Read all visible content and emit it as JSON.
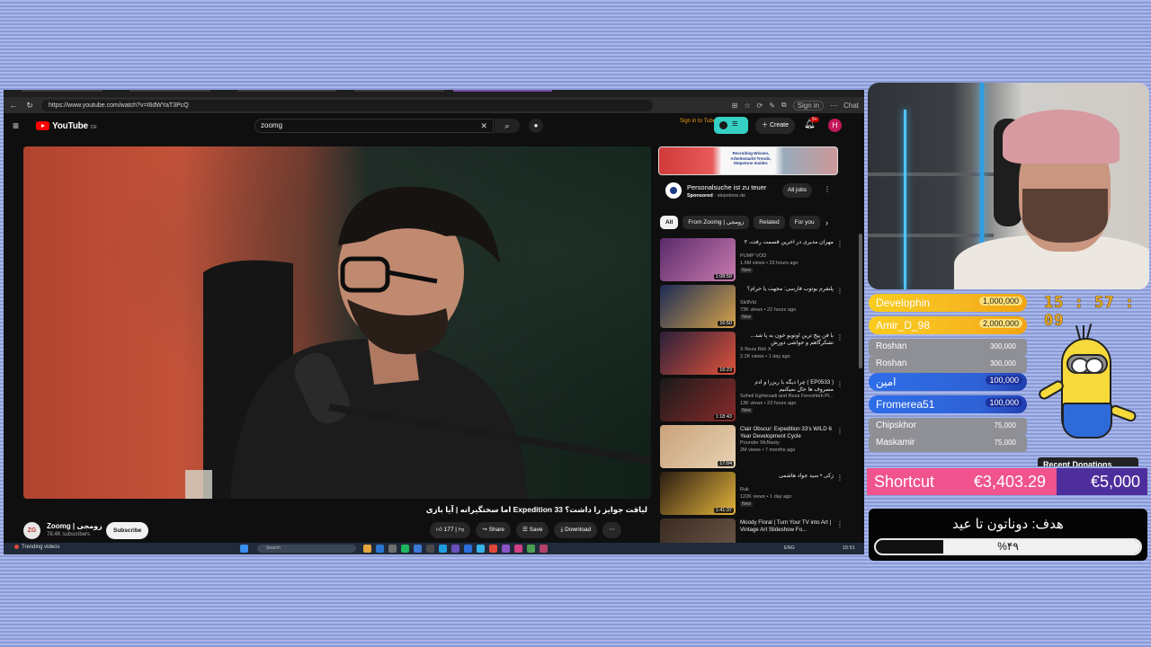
{
  "browser": {
    "url": "https://www.youtube.com/watch?v=I6dWYaT3PcQ",
    "signin": "Sign in",
    "chat": "Chat"
  },
  "youtube": {
    "logo": "YouTube",
    "region": "DE",
    "search_value": "zoomg",
    "tubebuddy": "Sign in to TubeBuddy",
    "create": "Create",
    "notifications": "9+",
    "avatar_letter": "H",
    "video": {
      "title": "لیاقت جوایز را داشت؟ Expedition 33 اما سختگیرانه | آیا بازی",
      "channel": "Zoomg | زومجی",
      "channel_avatar": "ZG",
      "subscribers": "78.4K subscribers",
      "subscribe": "Subscribe",
      "likes": "177",
      "share": "Share",
      "save": "Save",
      "download": "Download"
    },
    "ad": {
      "banner_text": "Recruiting-Wissen, Arbeitsmarkt-Trends, Stepstone Insider.",
      "title": "Personalsuche ist zu teuer",
      "sponsored": "Sponsored",
      "domain": "stepstone.de",
      "cta": "All jobs"
    },
    "chips": [
      "All",
      "From Zoomg | زومجی",
      "Related",
      "For you"
    ],
    "recommendations": [
      {
        "title": "مهران مدیری در آخرین قسمت رفت، ۲",
        "channel": "PUMP VOD",
        "meta": "1.6M views • 23 hours ago",
        "badge": "New",
        "duration": "1:08:59",
        "rtl": true,
        "colors": [
          "#5a2a6a",
          "#c97bb0"
        ]
      },
      {
        "title": "پلتفرم یوتوب فارسی: مجهت یا حرام؟",
        "channel": "SkillVid",
        "meta": "73K views • 22 hours ago",
        "badge": "New",
        "duration": "16:50",
        "rtl": true,
        "colors": [
          "#1c2b55",
          "#d6a24a"
        ]
      },
      {
        "title": "با فن پیج ترین اوتوبو خون به پا شد... تشکرگاهم و حواشی دورش",
        "channel": "X Reza Rsh X",
        "meta": "2.2K views • 1 day ago",
        "badge": "",
        "duration": "16:23",
        "rtl": true,
        "colors": [
          "#2a1f3a",
          "#e0533b"
        ]
      },
      {
        "title": "( EP0533 ) چرا دیگه با ریزرا و آدم مسروف ها حال نمیکنیم",
        "channel": "Soheil Eghtesadi and Reza Fereshteh Pl...",
        "meta": "13K views • 23 hours ago",
        "badge": "New",
        "duration": "1:18:43",
        "rtl": true,
        "colors": [
          "#1a1a1a",
          "#8a2a2a"
        ]
      },
      {
        "title": "Clair Obscur: Expedition 33's WILD 6 Year Development Cycle",
        "channel": "Pounder McNasty",
        "meta": "2M views • 7 months ago",
        "badge": "",
        "duration": "17:04",
        "rtl": false,
        "colors": [
          "#c9a27a",
          "#e7d2b3"
        ]
      },
      {
        "title": "زکی • سید جواد هاشمی",
        "channel": "Ruk",
        "meta": "122K views • 1 day ago",
        "badge": "New",
        "duration": "1:41:37",
        "rtl": true,
        "colors": [
          "#2a1d12",
          "#e4b33a"
        ]
      },
      {
        "title": "Moody Floral | Turn Your TV into Art | Vintage Art Slideshow Fo...",
        "channel": "",
        "meta": "",
        "badge": "",
        "duration": "",
        "rtl": false,
        "colors": [
          "#3a2a22",
          "#6e5a4a"
        ]
      }
    ]
  },
  "taskbar": {
    "weather": "Trending videos",
    "search": "Search",
    "lang": "ENG",
    "clock": "15:51"
  },
  "stream": {
    "clock": "15 : 57 : 09",
    "donors": [
      {
        "name": "Develophin",
        "amount": "1,000,000",
        "style": "gold"
      },
      {
        "name": "Amir_D_98",
        "amount": "2,000,000",
        "style": "gold"
      },
      {
        "name": "Roshan",
        "amount": "300,000",
        "style": "gray"
      },
      {
        "name": "Roshan",
        "amount": "300,000",
        "style": "gray"
      },
      {
        "name": "امین",
        "amount": "100,000",
        "style": "blue"
      },
      {
        "name": "Fromerea51",
        "amount": "100,000",
        "style": "blue"
      },
      {
        "name": "Chipskhor",
        "amount": "75,000",
        "style": "gray"
      },
      {
        "name": "Maskamir",
        "amount": "75,000",
        "style": "gray"
      }
    ],
    "minion_label": "Recent Donations",
    "shortcut": {
      "label": "Shortcut",
      "raised": "€3,403.29",
      "target": "€5,000"
    },
    "goal": {
      "title": "هدف: دوناتون تا عید",
      "percent_text": "%۴۹",
      "percent": 49
    }
  }
}
